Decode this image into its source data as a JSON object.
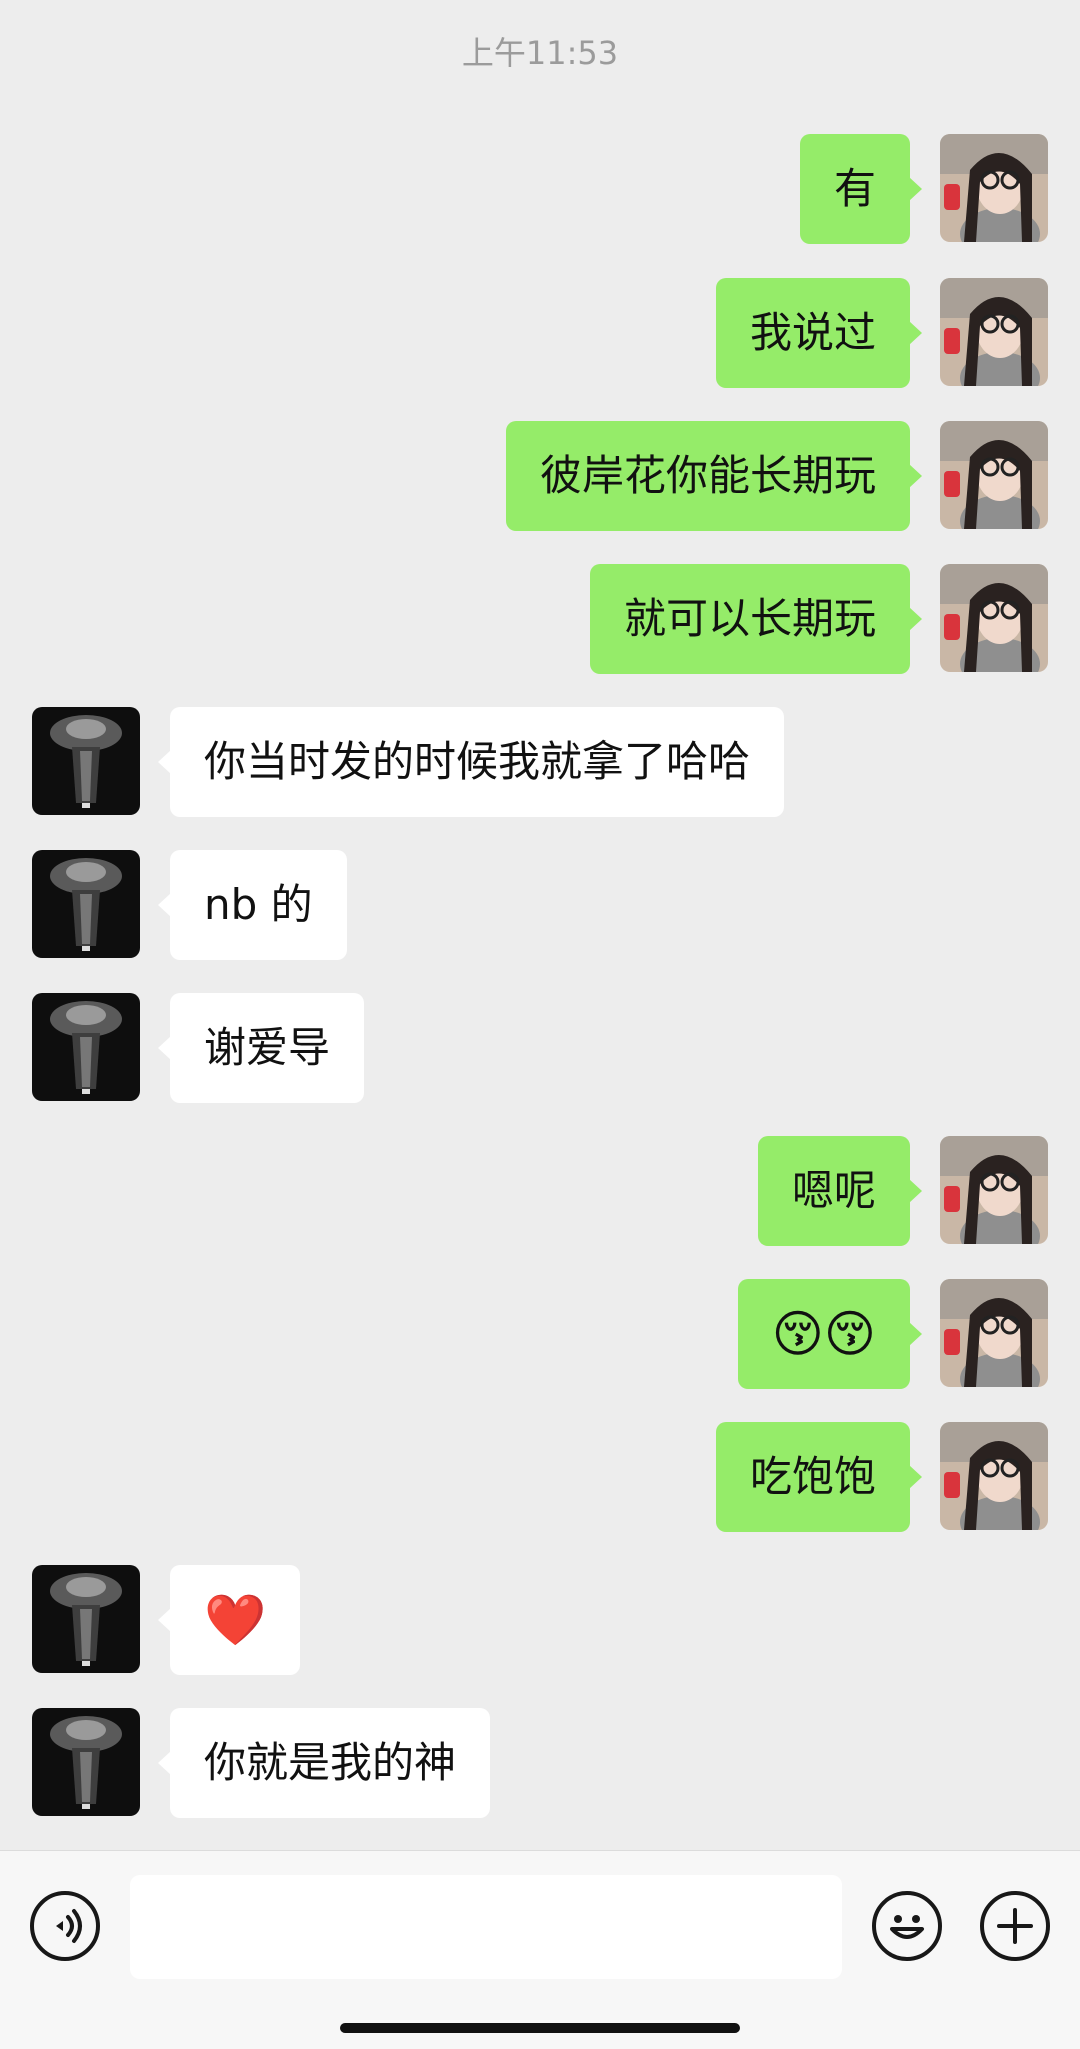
{
  "chat": {
    "timestamp": "上午11:53",
    "messages": [
      {
        "sender": "me",
        "text": "有"
      },
      {
        "sender": "me",
        "text": "我说过"
      },
      {
        "sender": "me",
        "text": "彼岸花你能长期玩"
      },
      {
        "sender": "me",
        "text": "就可以长期玩"
      },
      {
        "sender": "them",
        "text": "你当时发的时候我就拿了哈哈"
      },
      {
        "sender": "them",
        "text": "nb 的"
      },
      {
        "sender": "them",
        "text": "谢爱导"
      },
      {
        "sender": "me",
        "text": "嗯呢"
      },
      {
        "sender": "me",
        "text": "😚😚"
      },
      {
        "sender": "me",
        "text": "吃饱饱"
      },
      {
        "sender": "them",
        "text": "❤️"
      },
      {
        "sender": "them",
        "text": "你就是我的神"
      }
    ]
  },
  "composer": {
    "input_value": "",
    "icons": [
      "voice-icon",
      "emoji-icon",
      "plus-icon"
    ]
  },
  "colors": {
    "background": "#ededed",
    "my_bubble": "#95ec69",
    "their_bubble": "#ffffff"
  }
}
